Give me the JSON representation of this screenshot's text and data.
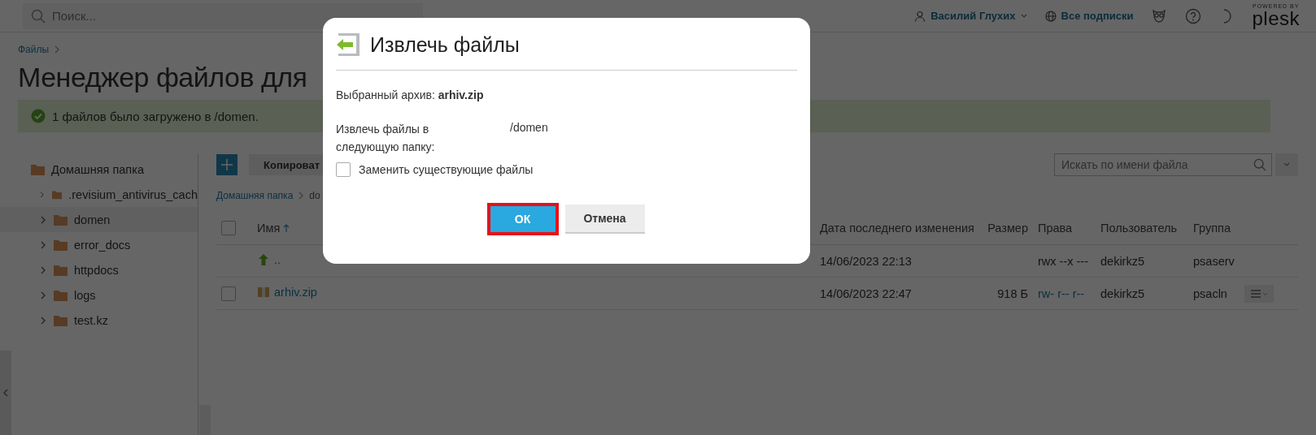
{
  "header": {
    "search": {
      "placeholder": "Поиск..."
    },
    "user": "Василий Глухих",
    "subscriptions": "Все подписки",
    "brand": {
      "tagline": "POWERED BY",
      "name": "plesk"
    }
  },
  "breadcrumb": [
    "Файлы"
  ],
  "page_title": "Менеджер файлов для",
  "alert": {
    "text": "1 файлов было загружено в /domen."
  },
  "tree": {
    "label": "Домашняя папка",
    "children": [
      {
        "label": ".revisium_antivirus_cach",
        "selected": false,
        "expanded": false
      },
      {
        "label": "domen",
        "selected": true,
        "expanded": false
      },
      {
        "label": "error_docs",
        "selected": false,
        "expanded": false
      },
      {
        "label": "httpdocs",
        "selected": false,
        "expanded": false
      },
      {
        "label": "logs",
        "selected": false,
        "expanded": false
      },
      {
        "label": "test.kz",
        "selected": false,
        "expanded": false
      }
    ]
  },
  "toolbar": {
    "copy_button": "Копироват",
    "search": {
      "placeholder": "Искать по имени файла"
    }
  },
  "path": [
    "Домашняя папка",
    "do"
  ],
  "table": {
    "select_all": {
      "checked": false
    },
    "columns": [
      {
        "label": "Имя",
        "sorted": true
      },
      {
        "label": "Дата последнего изменения",
        "sorted": false
      },
      {
        "label": "Размер",
        "sorted": false
      },
      {
        "label": "Права",
        "sorted": false
      },
      {
        "label": "Пользователь",
        "sorted": false
      },
      {
        "label": "Группа",
        "sorted": false
      }
    ],
    "rows": [
      {
        "kind": "parent",
        "name": "..",
        "date": "14/06/2023 22:13",
        "perms": "rwx --x ---",
        "perms_link": false,
        "user": "dekirkz5",
        "group": "psaserv"
      },
      {
        "kind": "file",
        "checked": false,
        "name": "arhiv.zip",
        "date": "14/06/2023 22:47",
        "size": "918 Б",
        "perms": "rw- r-- r--",
        "perms_link": true,
        "user": "dekirkz5",
        "group": "psacln"
      }
    ]
  },
  "dialog": {
    "title": "Извлечь файлы",
    "archive": "Выбранный архив: **arhiv.zip**",
    "target_label": "Извлечь файлы в следующую папку:",
    "target_value": "/domen",
    "replace": {
      "label": "Заменить существующие файлы",
      "checked": false
    },
    "buttons": [
      {
        "label": "ОК",
        "kind": "primary",
        "highlighted": true
      },
      {
        "label": "Отмена",
        "kind": "secondary",
        "highlighted": false
      }
    ]
  }
}
